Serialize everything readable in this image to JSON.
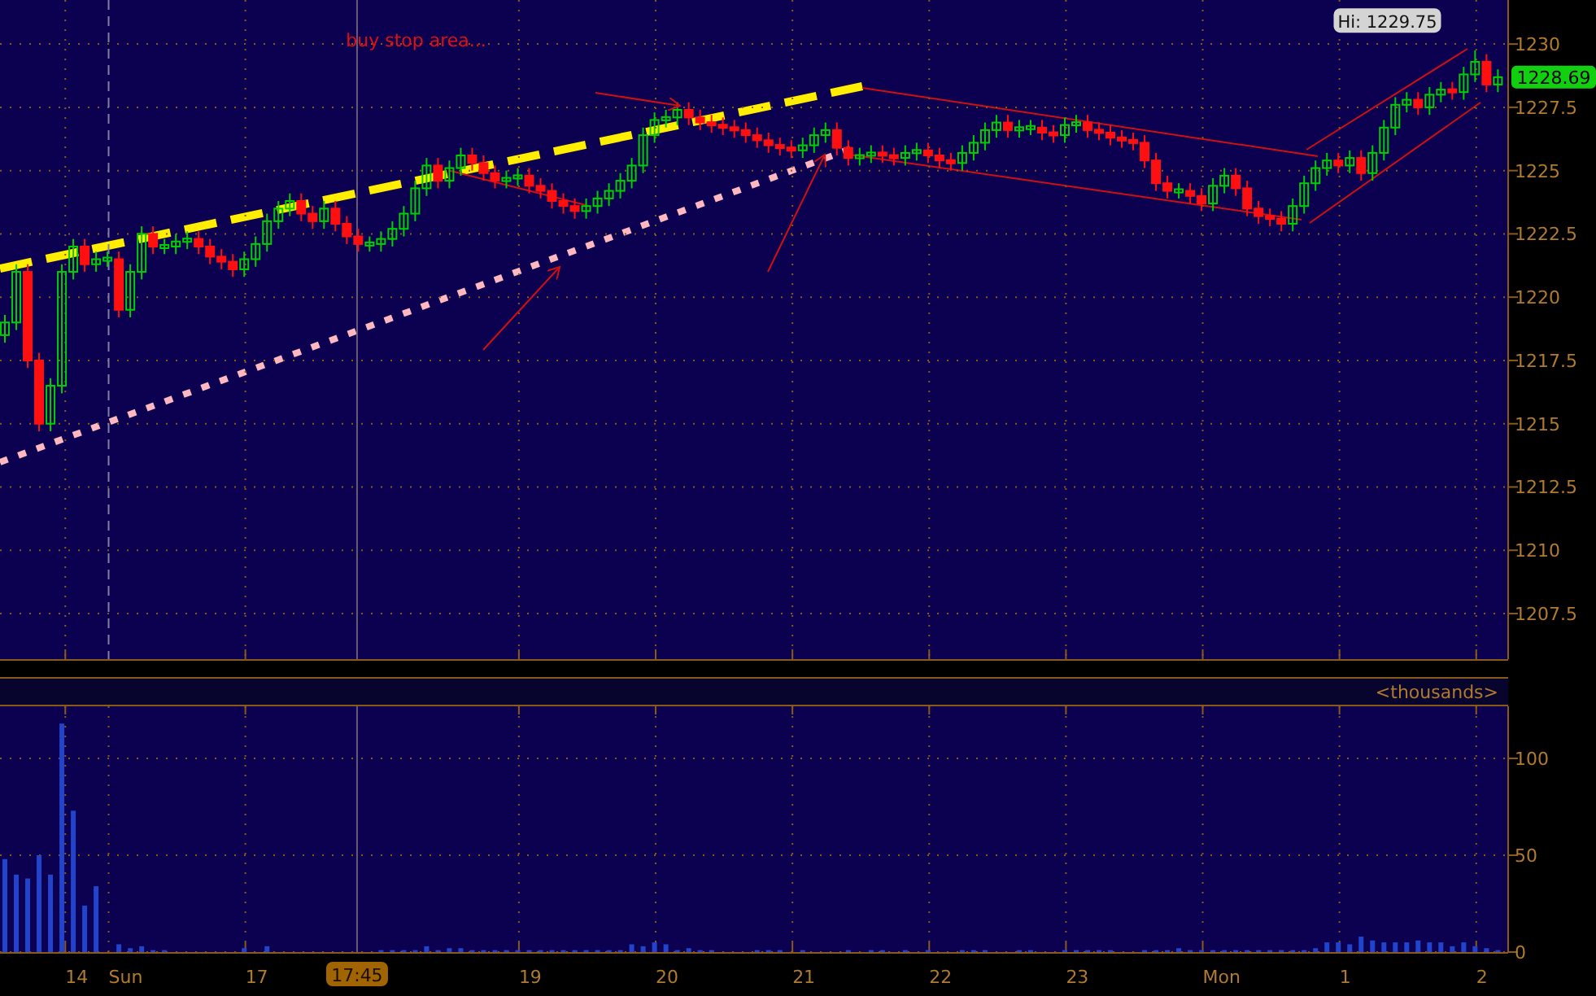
{
  "time_axis": [
    "14",
    "Sun",
    "17",
    "19",
    "20",
    "21",
    "22",
    "23",
    "Mon",
    "1",
    "2"
  ],
  "last_price": "1228.69",
  "price_pane": {
    "chart_data": {
      "type": "candlestick",
      "grid": true,
      "ylim": [
        1205.7,
        1231.74
      ],
      "yticks": [
        {
          "value": 1230,
          "label": "1230"
        },
        {
          "value": 1227.5,
          "label": "1227.5"
        },
        {
          "value": 1225,
          "label": "1225"
        },
        {
          "value": 1222.5,
          "label": "1222.5"
        },
        {
          "value": 1220,
          "label": "1220"
        },
        {
          "value": 1217.5,
          "label": "1217.5"
        },
        {
          "value": 1215,
          "label": "1215"
        },
        {
          "value": 1212.5,
          "label": "1212.5"
        },
        {
          "value": 1210,
          "label": "1210"
        },
        {
          "value": 1207.5,
          "label": "1207.5"
        }
      ],
      "ohlc": [
        [
          1218.5,
          1219.3,
          1218.2,
          1219
        ],
        [
          1219,
          1221.3,
          1218.7,
          1221
        ],
        [
          1221,
          1221.3,
          1217.2,
          1217.5
        ],
        [
          1217.5,
          1217.8,
          1214.7,
          1215
        ],
        [
          1215,
          1216.8,
          1214.7,
          1216.5
        ],
        [
          1216.5,
          1221.3,
          1216.2,
          1221
        ],
        [
          1221,
          1222.3,
          1220.7,
          1222
        ],
        [
          1222,
          1222.3,
          1221,
          1221.3
        ],
        [
          1221.3,
          1221.8,
          1221,
          1221.5
        ],
        [
          1221.5,
          1221.8,
          1221.2,
          1221.5
        ],
        [
          1221.5,
          1221.8,
          1219.2,
          1219.5
        ],
        [
          1219.5,
          1221.3,
          1219.2,
          1221
        ],
        [
          1221,
          1222.8,
          1220.7,
          1222.5
        ],
        [
          1222.5,
          1222.8,
          1221.7,
          1222
        ],
        [
          1222,
          1222.3,
          1221.7,
          1222
        ],
        [
          1222,
          1222.5,
          1221.7,
          1222.2
        ],
        [
          1222.2,
          1222.6,
          1221.9,
          1222.3
        ],
        [
          1222.3,
          1222.6,
          1221.7,
          1222
        ],
        [
          1222,
          1222.3,
          1221.3,
          1221.6
        ],
        [
          1221.6,
          1221.9,
          1221.1,
          1221.4
        ],
        [
          1221.4,
          1221.7,
          1220.8,
          1221.1
        ],
        [
          1221.1,
          1221.8,
          1220.8,
          1221.5
        ],
        [
          1221.5,
          1222.4,
          1221.2,
          1222.1
        ],
        [
          1222.1,
          1223.3,
          1221.8,
          1223
        ],
        [
          1223,
          1223.8,
          1222.7,
          1223.5
        ],
        [
          1223.5,
          1224.1,
          1223.2,
          1223.8
        ],
        [
          1223.8,
          1224.1,
          1223,
          1223.3
        ],
        [
          1223.3,
          1223.6,
          1222.7,
          1223
        ],
        [
          1223,
          1223.8,
          1222.7,
          1223.5
        ],
        [
          1223.5,
          1223.8,
          1222.6,
          1222.9
        ],
        [
          1222.9,
          1223.2,
          1222.1,
          1222.4
        ],
        [
          1222.4,
          1222.7,
          1221.8,
          1222.1
        ],
        [
          1222.1,
          1222.4,
          1221.8,
          1222.1
        ],
        [
          1222.1,
          1222.6,
          1221.8,
          1222.3
        ],
        [
          1222.3,
          1223,
          1222,
          1222.7
        ],
        [
          1222.7,
          1223.6,
          1222.4,
          1223.3
        ],
        [
          1223.3,
          1224.6,
          1223,
          1224.3
        ],
        [
          1224.3,
          1225.5,
          1224,
          1225.2
        ],
        [
          1225.2,
          1225.5,
          1224.3,
          1224.6
        ],
        [
          1224.6,
          1225.4,
          1224.3,
          1225.1
        ],
        [
          1225.1,
          1225.9,
          1224.8,
          1225.6
        ],
        [
          1225.6,
          1225.9,
          1225,
          1225.3
        ],
        [
          1225.3,
          1225.6,
          1224.6,
          1224.9
        ],
        [
          1224.9,
          1225.2,
          1224.3,
          1224.6
        ],
        [
          1224.6,
          1225,
          1224.3,
          1224.7
        ],
        [
          1224.7,
          1225.1,
          1224.4,
          1224.8
        ],
        [
          1224.8,
          1225.1,
          1224.1,
          1224.4
        ],
        [
          1224.4,
          1224.7,
          1223.9,
          1224.2
        ],
        [
          1224.2,
          1224.5,
          1223.5,
          1223.8
        ],
        [
          1223.8,
          1224.1,
          1223.3,
          1223.6
        ],
        [
          1223.6,
          1223.9,
          1223.1,
          1223.4
        ],
        [
          1223.4,
          1223.9,
          1223.1,
          1223.6
        ],
        [
          1223.6,
          1224.2,
          1223.3,
          1223.9
        ],
        [
          1223.9,
          1224.5,
          1223.6,
          1224.2
        ],
        [
          1224.2,
          1224.9,
          1223.9,
          1224.6
        ],
        [
          1224.6,
          1225.5,
          1224.3,
          1225.2
        ],
        [
          1225.2,
          1226.7,
          1224.9,
          1226.4
        ],
        [
          1226.4,
          1227.3,
          1226.1,
          1227
        ],
        [
          1227,
          1227.4,
          1226.7,
          1227.1
        ],
        [
          1227.1,
          1227.7,
          1226.8,
          1227.4
        ],
        [
          1227.4,
          1227.7,
          1226.8,
          1227.1
        ],
        [
          1227.1,
          1227.4,
          1226.6,
          1226.9
        ],
        [
          1226.9,
          1227.2,
          1226.5,
          1226.8
        ],
        [
          1226.8,
          1227.1,
          1226.4,
          1226.7
        ],
        [
          1226.7,
          1227,
          1226.3,
          1226.6
        ],
        [
          1226.6,
          1226.9,
          1226.1,
          1226.4
        ],
        [
          1226.4,
          1226.7,
          1225.9,
          1226.2
        ],
        [
          1226.2,
          1226.5,
          1225.7,
          1226
        ],
        [
          1226,
          1226.3,
          1225.6,
          1225.9
        ],
        [
          1225.9,
          1226.2,
          1225.5,
          1225.8
        ],
        [
          1225.8,
          1226.3,
          1225.5,
          1226
        ],
        [
          1226,
          1226.7,
          1225.7,
          1226.4
        ],
        [
          1226.4,
          1226.9,
          1226.1,
          1226.6
        ],
        [
          1226.6,
          1226.9,
          1225.6,
          1225.9
        ],
        [
          1225.9,
          1226.2,
          1225.2,
          1225.5
        ],
        [
          1225.5,
          1225.9,
          1225.2,
          1225.6
        ],
        [
          1225.6,
          1226,
          1225.3,
          1225.7
        ],
        [
          1225.7,
          1226,
          1225.3,
          1225.6
        ],
        [
          1225.6,
          1225.9,
          1225.2,
          1225.5
        ],
        [
          1225.5,
          1226,
          1225.2,
          1225.7
        ],
        [
          1225.7,
          1226.1,
          1225.4,
          1225.8
        ],
        [
          1225.8,
          1226.1,
          1225.3,
          1225.6
        ],
        [
          1225.6,
          1225.9,
          1225.1,
          1225.4
        ],
        [
          1225.4,
          1225.7,
          1225,
          1225.3
        ],
        [
          1225.3,
          1226,
          1225,
          1225.7
        ],
        [
          1225.7,
          1226.4,
          1225.4,
          1226.1
        ],
        [
          1226.1,
          1226.9,
          1225.8,
          1226.6
        ],
        [
          1226.6,
          1227.2,
          1226.3,
          1226.9
        ],
        [
          1226.9,
          1227.2,
          1226.3,
          1226.6
        ],
        [
          1226.6,
          1227,
          1226.3,
          1226.7
        ],
        [
          1226.7,
          1227,
          1226.4,
          1226.7
        ],
        [
          1226.7,
          1227,
          1226.2,
          1226.5
        ],
        [
          1226.5,
          1226.8,
          1226.1,
          1226.4
        ],
        [
          1226.4,
          1227.1,
          1226.1,
          1226.8
        ],
        [
          1226.8,
          1227.2,
          1226.5,
          1226.9
        ],
        [
          1226.9,
          1227.2,
          1226.3,
          1226.6
        ],
        [
          1226.6,
          1226.9,
          1226.2,
          1226.5
        ],
        [
          1226.5,
          1226.8,
          1226,
          1226.3
        ],
        [
          1226.3,
          1226.6,
          1225.9,
          1226.2
        ],
        [
          1226.2,
          1226.5,
          1225.8,
          1226.1
        ],
        [
          1226.1,
          1226.4,
          1225.1,
          1225.4
        ],
        [
          1225.4,
          1225.7,
          1224.2,
          1224.5
        ],
        [
          1224.5,
          1224.8,
          1223.9,
          1224.2
        ],
        [
          1224.2,
          1224.5,
          1223.9,
          1224.2
        ],
        [
          1224.2,
          1224.5,
          1223.7,
          1224
        ],
        [
          1224,
          1224.3,
          1223.4,
          1223.7
        ],
        [
          1223.7,
          1224.7,
          1223.4,
          1224.4
        ],
        [
          1224.4,
          1225.1,
          1224.1,
          1224.8
        ],
        [
          1224.8,
          1225.1,
          1224,
          1224.3
        ],
        [
          1224.3,
          1224.6,
          1223.2,
          1223.5
        ],
        [
          1223.5,
          1223.8,
          1222.9,
          1223.2
        ],
        [
          1223.2,
          1223.5,
          1222.8,
          1223.1
        ],
        [
          1223.1,
          1223.4,
          1222.6,
          1222.9
        ],
        [
          1222.9,
          1223.9,
          1222.6,
          1223.6
        ],
        [
          1223.6,
          1224.8,
          1223.3,
          1224.5
        ],
        [
          1224.5,
          1225.4,
          1224.2,
          1225.1
        ],
        [
          1225.1,
          1225.7,
          1224.8,
          1225.4
        ],
        [
          1225.4,
          1225.7,
          1224.9,
          1225.2
        ],
        [
          1225.2,
          1225.8,
          1224.9,
          1225.5
        ],
        [
          1225.5,
          1225.8,
          1224.6,
          1224.9
        ],
        [
          1224.9,
          1226,
          1224.6,
          1225.7
        ],
        [
          1225.7,
          1227,
          1225.4,
          1226.7
        ],
        [
          1226.7,
          1227.9,
          1226.4,
          1227.6
        ],
        [
          1227.6,
          1228.1,
          1227.3,
          1227.8
        ],
        [
          1227.8,
          1228.1,
          1227.2,
          1227.5
        ],
        [
          1227.5,
          1228.3,
          1227.2,
          1228
        ],
        [
          1228,
          1228.5,
          1227.7,
          1228.2
        ],
        [
          1228.2,
          1228.5,
          1227.8,
          1228.1
        ],
        [
          1228.1,
          1229.1,
          1227.8,
          1228.8
        ],
        [
          1228.8,
          1229.75,
          1228.5,
          1229.3
        ],
        [
          1229.3,
          1229.6,
          1228.1,
          1228.4
        ],
        [
          1228.4,
          1229,
          1228.1,
          1228.69
        ]
      ],
      "annotations": [
        "buy stop area...",
        "Hi: 1229.75"
      ]
    }
  },
  "volume_pane": {
    "chart_data": {
      "type": "bar",
      "grid": true,
      "ylabel": "<thousands>",
      "ylim": [
        0,
        126.9
      ],
      "yticks": [
        {
          "value": 100,
          "label": "100"
        },
        {
          "value": 50,
          "label": "50"
        },
        {
          "value": 0,
          "label": "0"
        }
      ],
      "values": [
        48,
        40,
        38,
        50,
        40,
        118,
        73,
        24,
        34,
        null,
        4,
        2,
        3,
        1,
        1,
        null,
        null,
        null,
        null,
        null,
        null,
        2,
        null,
        3,
        null,
        null,
        null,
        null,
        null,
        null,
        null,
        null,
        null,
        1,
        1,
        1,
        1,
        3,
        1,
        2,
        2,
        1,
        1,
        1,
        1,
        1,
        1,
        1,
        1,
        1,
        1,
        1,
        1,
        1,
        1,
        4,
        3,
        5,
        4,
        1,
        2,
        1,
        1,
        null,
        null,
        null,
        1,
        1,
        1,
        null,
        1,
        null,
        null,
        null,
        1,
        null,
        1,
        1,
        null,
        1,
        null,
        1,
        null,
        null,
        1,
        1,
        1,
        null,
        null,
        1,
        1,
        null,
        null,
        1,
        1,
        1,
        1,
        1,
        null,
        null,
        1,
        1,
        1,
        2,
        1,
        1,
        1,
        1,
        1,
        1,
        1,
        1,
        1,
        1,
        1,
        2,
        5,
        5,
        4,
        8,
        6,
        5,
        5,
        5,
        6,
        5,
        5,
        3,
        5,
        3,
        2,
        1
      ],
      "annotations": [
        "17:45"
      ]
    }
  }
}
